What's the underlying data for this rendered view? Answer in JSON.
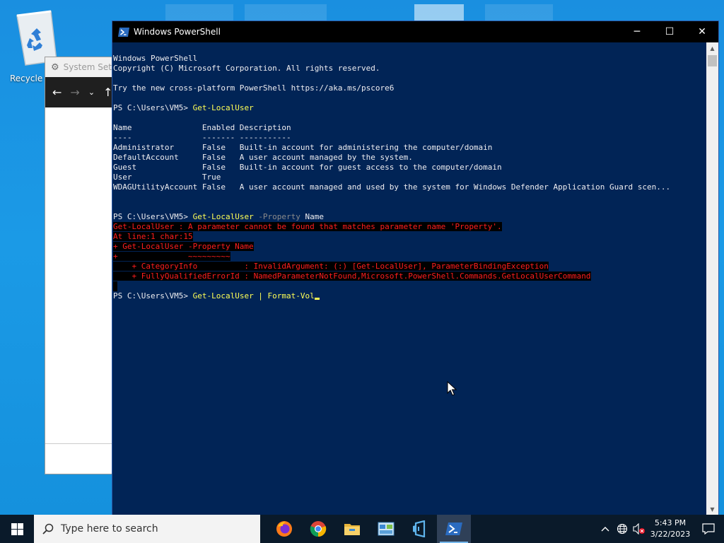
{
  "desktop": {
    "recycle_bin_label": "Recycle Bin"
  },
  "settings_window": {
    "title": "System Settings"
  },
  "powershell": {
    "title": "Windows PowerShell",
    "controls": {
      "minimize": "─",
      "maximize": "☐",
      "close": "✕"
    },
    "banner": [
      "Windows PowerShell",
      "Copyright (C) Microsoft Corporation. All rights reserved.",
      "",
      "Try the new cross-platform PowerShell https://aka.ms/pscore6"
    ],
    "prompt": "PS C:\\Users\\VM5> ",
    "cmd1": "Get-LocalUser",
    "table_header": "Name               Enabled Description",
    "table_rule": "----               ------- -----------",
    "rows": [
      "Administrator      False   Built-in account for administering the computer/domain",
      "DefaultAccount     False   A user account managed by the system.",
      "Guest              False   Built-in account for guest access to the computer/domain",
      "User               True",
      "WDAGUtilityAccount False   A user account managed and used by the system for Windows Defender Application Guard scen..."
    ],
    "cmd2_name": "Get-LocalUser",
    "cmd2_param": "-Property",
    "cmd2_arg": "Name",
    "errors": [
      "Get-LocalUser : A parameter cannot be found that matches parameter name 'Property'.",
      "At line:1 char:15",
      "+ Get-LocalUser -Property Name",
      "+               ~~~~~~~~~",
      "    + CategoryInfo          : InvalidArgument: (:) [Get-LocalUser], ParameterBindingException",
      "    + FullyQualifiedErrorId : NamedParameterNotFound,Microsoft.PowerShell.Commands.GetLocalUserCommand"
    ],
    "cmd3": "Get-LocalUser | Format-Vol"
  },
  "taskbar": {
    "search_placeholder": "Type here to search",
    "apps": [
      "firefox",
      "chrome",
      "file-explorer",
      "control-panel",
      "azure-data-studio",
      "powershell"
    ],
    "clock_time": "5:43 PM",
    "clock_date": "3/22/2023"
  },
  "colors": {
    "ps_background": "#012456",
    "ps_command": "#ffff55",
    "ps_error": "#ff1e1e",
    "taskbar": "#0a1a2a"
  }
}
